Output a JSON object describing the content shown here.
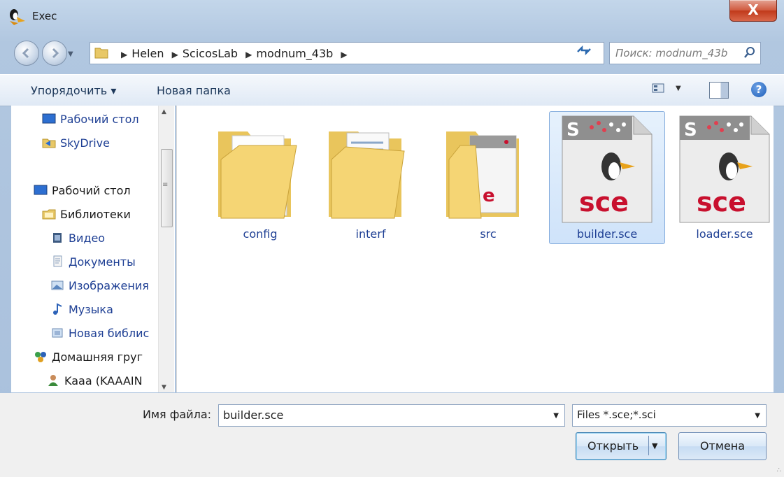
{
  "window": {
    "title": "Exec",
    "close_label": "X"
  },
  "address": {
    "crumbs": [
      "Helen",
      "ScicosLab",
      "modnum_43b"
    ],
    "search_placeholder": "Поиск: modnum_43b"
  },
  "toolbar": {
    "organize_label": "Упорядочить ▾",
    "new_folder_label": "Новая папка",
    "help_label": "?"
  },
  "navigation": {
    "items": [
      {
        "label": "Рабочий стол",
        "icon": "desktop-icon"
      },
      {
        "label": "SkyDrive",
        "icon": "skydrive-icon"
      },
      {
        "label": "Рабочий стол",
        "icon": "desktop-icon"
      },
      {
        "label": "Библиотеки",
        "icon": "libraries-icon"
      },
      {
        "label": "Видео",
        "icon": "video-icon"
      },
      {
        "label": "Документы",
        "icon": "documents-icon"
      },
      {
        "label": "Изображения",
        "icon": "pictures-icon"
      },
      {
        "label": "Музыка",
        "icon": "music-icon"
      },
      {
        "label": "Новая библис",
        "icon": "library-icon"
      },
      {
        "label": "Домашняя груг",
        "icon": "homegroup-icon"
      },
      {
        "label": "Kaaa (KAAAIN",
        "icon": "user-icon"
      }
    ]
  },
  "files": [
    {
      "name": "config",
      "kind": "folder",
      "selected": false
    },
    {
      "name": "interf",
      "kind": "folder",
      "selected": false
    },
    {
      "name": "src",
      "kind": "folder",
      "selected": false
    },
    {
      "name": "builder.sce",
      "kind": "sce-file",
      "badge": "sce",
      "selected": true
    },
    {
      "name": "loader.sce",
      "kind": "sce-file",
      "badge": "sce",
      "selected": false
    }
  ],
  "footer": {
    "filename_label": "Имя файла:",
    "filename_value": "builder.sce",
    "filter_value": "Files *.sce;*.sci",
    "open_label": "Открыть",
    "cancel_label": "Отмена"
  },
  "colors": {
    "link": "#1e3f94",
    "selection": "#cfe3fa",
    "sce_red": "#c8102e"
  }
}
